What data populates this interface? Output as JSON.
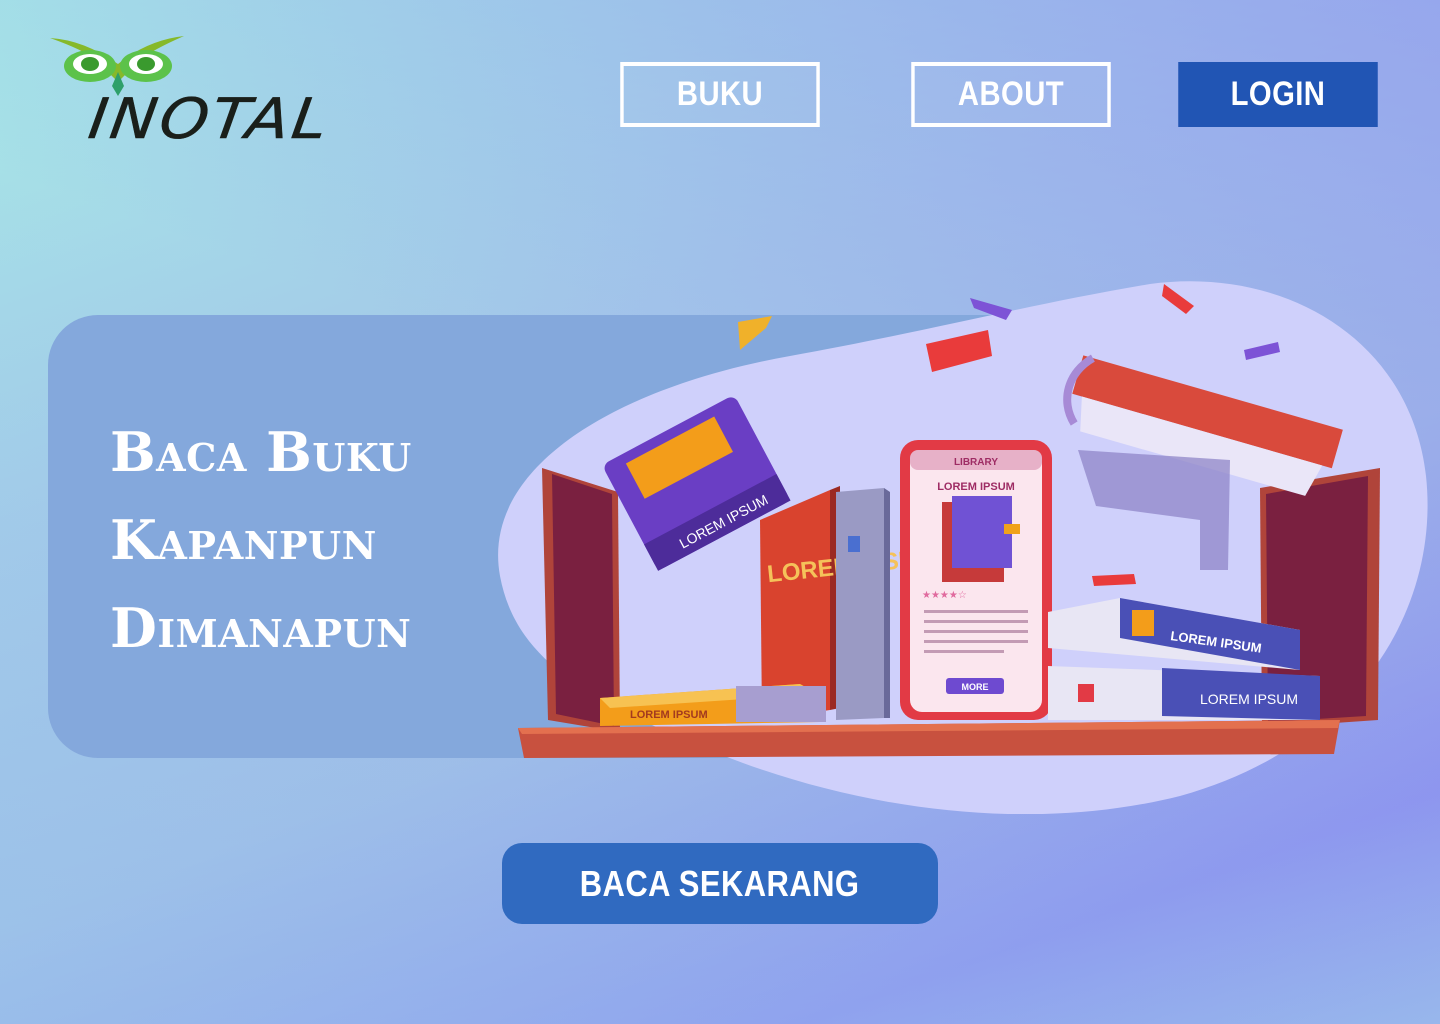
{
  "brand": {
    "name": "INOTAL",
    "colors": {
      "owl_green": "#6fbe2c",
      "text": "#1a1f1a"
    }
  },
  "nav": {
    "items": [
      {
        "label": "BUKU"
      },
      {
        "label": "ABOUT"
      },
      {
        "label": "LOGIN"
      }
    ],
    "login_color": "#2155b4"
  },
  "hero": {
    "title_lines": [
      "Baca Buku",
      "Kapanpun",
      "Dimanapun"
    ],
    "panel_color": "#84a8dc",
    "illustration": {
      "phone_header": "LIBRARY",
      "phone_book_title": "LOREM IPSUM",
      "phone_button": "MORE",
      "book_labels": [
        "LOREM IPSUM",
        "LOREM IPSUM",
        "LOREM IPSUM",
        "LOREM IPSUM",
        "LOREM IPSUM"
      ]
    }
  },
  "cta": {
    "label": "BACA SEKARANG",
    "color": "#306ac0"
  }
}
